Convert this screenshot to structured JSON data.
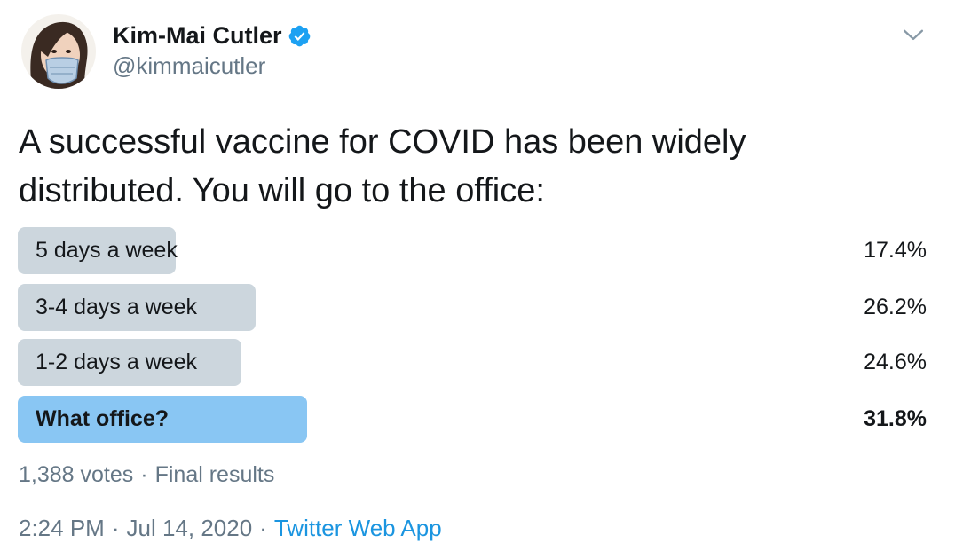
{
  "author": {
    "display_name": "Kim-Mai Cutler",
    "handle": "@kimmaicutler",
    "verified": true
  },
  "icons": {
    "verified": "verified-badge-icon",
    "menu": "chevron-down-icon"
  },
  "tweet": {
    "text": "A successful vaccine for COVID has been widely\ndistributed. You will go to the office:"
  },
  "poll": {
    "options": [
      {
        "label": "5 days a week",
        "percent_text": "17.4%",
        "percent": 17.4,
        "winner": false
      },
      {
        "label": "3-4 days a week",
        "percent_text": "26.2%",
        "percent": 26.2,
        "winner": false
      },
      {
        "label": "1-2 days a week",
        "percent_text": "24.6%",
        "percent": 24.6,
        "winner": false
      },
      {
        "label": "What office?",
        "percent_text": "31.8%",
        "percent": 31.8,
        "winner": true
      }
    ],
    "votes": "1,388 votes",
    "separator": "·",
    "status": "Final results"
  },
  "meta": {
    "time": "2:24 PM",
    "separator": "·",
    "date": "Jul 14, 2020",
    "source": "Twitter Web App"
  },
  "colors": {
    "bar": "#ccd6dd",
    "winner_bar": "#89c6f3",
    "secondary_text": "#657786",
    "link": "#1b95e0",
    "verified": "#1da1f2"
  }
}
